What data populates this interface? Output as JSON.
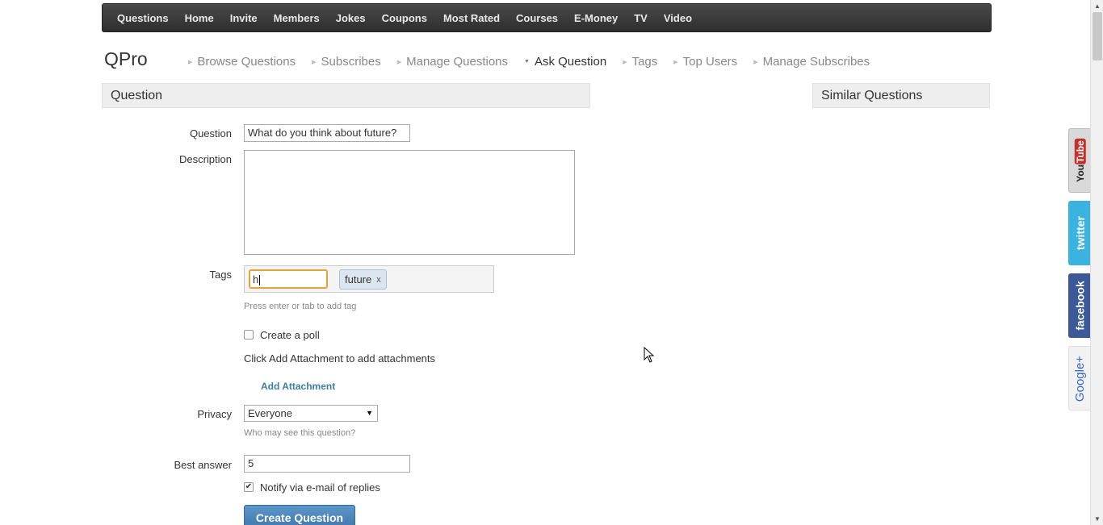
{
  "topnav": {
    "items": [
      "Questions",
      "Home",
      "Invite",
      "Members",
      "Jokes",
      "Coupons",
      "Most Rated",
      "Courses",
      "E-Money",
      "TV",
      "Video"
    ]
  },
  "brand": "QPro",
  "subnav": {
    "items": [
      {
        "label": "Browse Questions",
        "active": false
      },
      {
        "label": "Subscribes",
        "active": false
      },
      {
        "label": "Manage Questions",
        "active": false
      },
      {
        "label": "Ask Question",
        "active": true
      },
      {
        "label": "Tags",
        "active": false
      },
      {
        "label": "Top Users",
        "active": false
      },
      {
        "label": "Manage Subscribes",
        "active": false
      }
    ]
  },
  "sections": {
    "question": "Question",
    "similar": "Similar Questions"
  },
  "form": {
    "question_label": "Question",
    "question_value": "What do you think about future?",
    "description_label": "Description",
    "tags_label": "Tags",
    "tag_input_value": "h",
    "tag_chip": "future",
    "tag_chip_remove": "x",
    "tags_hint": "Press enter or tab to add tag",
    "poll_label": "Create a poll",
    "poll_checked": false,
    "attachment_text": "Click Add Attachment to add attachments",
    "add_attachment": "Add Attachment",
    "privacy_label": "Privacy",
    "privacy_value": "Everyone",
    "privacy_hint": "Who may see this question?",
    "best_answer_label": "Best answer",
    "best_answer_value": "5",
    "notify_label": "Notify via e-mail of replies",
    "notify_checked": true,
    "submit": "Create Question"
  },
  "social": {
    "youtube": "You",
    "youtube_b": "Tube",
    "twitter": "twitter",
    "facebook": "facebook",
    "googleplus": "Google+"
  },
  "icons": {
    "check": "✔",
    "dropdown": "▼",
    "scroll_up": "▲",
    "scroll_down": "▼",
    "arrow_right": "▶",
    "arrow_down": "▼"
  }
}
